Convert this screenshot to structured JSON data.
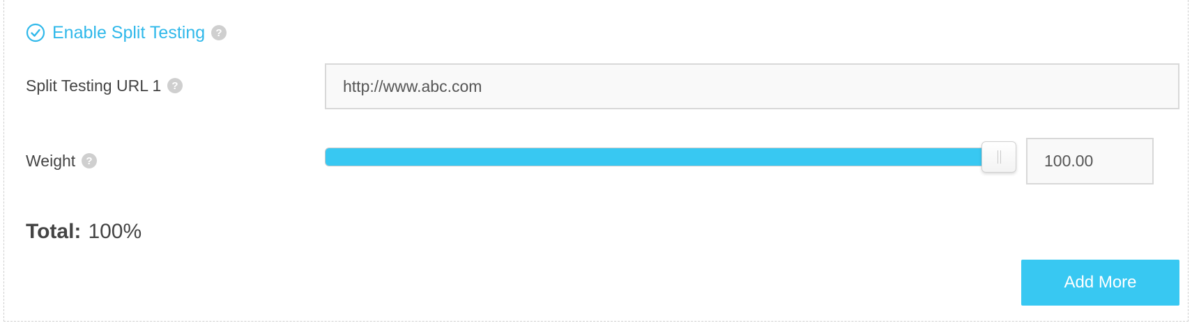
{
  "colors": {
    "accent": "#38c8f2",
    "enable_label": "#2fb8ea",
    "help_icon": "#cfcfcf",
    "text": "#444444"
  },
  "split_testing": {
    "enable_label": "Enable Split Testing",
    "enabled": true,
    "enable_icon": "check-circle-icon",
    "help_icon": "question-circle-icon",
    "url_label": "Split Testing URL 1",
    "url_value": "http://www.abc.com",
    "weight_label": "Weight",
    "weight_value": "100.00",
    "weight_percent": 100,
    "total_label": "Total:",
    "total_value": "100%",
    "add_more_label": "Add More"
  }
}
